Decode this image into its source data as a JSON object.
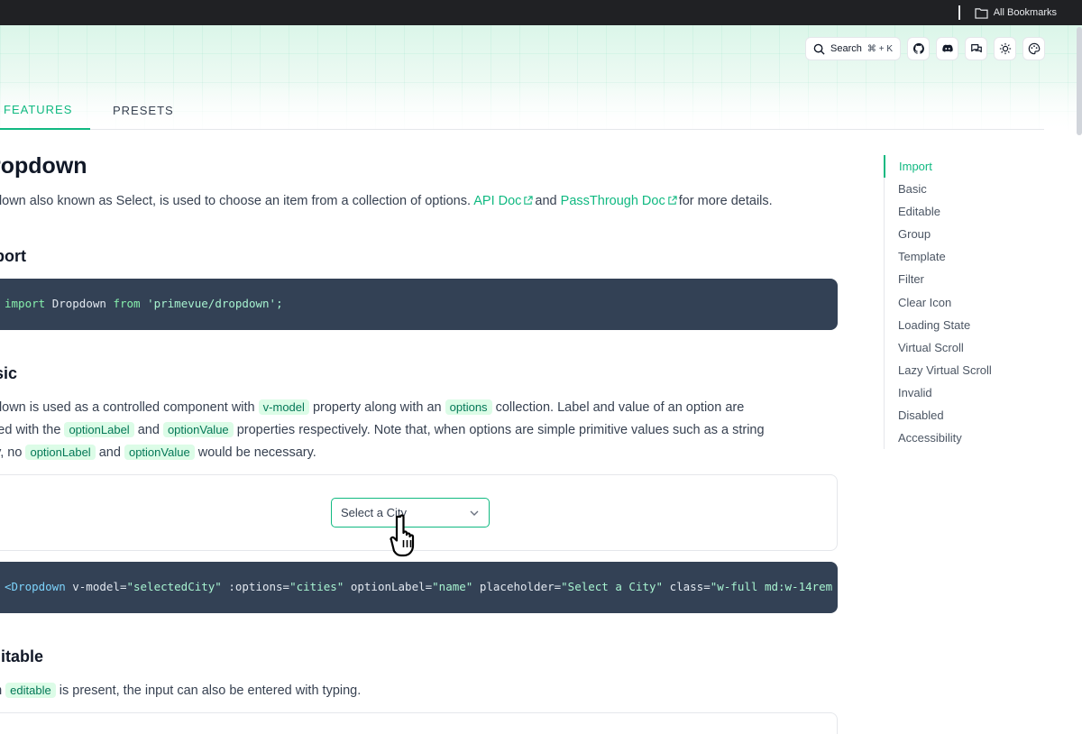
{
  "browser": {
    "bookmarks_label": "All Bookmarks"
  },
  "toolbar": {
    "search_label": "Search",
    "search_shortcut": "⌘ + K"
  },
  "tabs": [
    {
      "label": "FEATURES"
    },
    {
      "label": "PRESETS"
    }
  ],
  "page": {
    "title": "ropdown",
    "desc_pre": "pdown also known as Select, is used to choose an item from a collection of options.",
    "api_doc": "API Doc",
    "desc_and": "and",
    "pt_doc": "PassThrough Doc",
    "desc_post": "for more details."
  },
  "import_section": {
    "heading": "port",
    "code_kw1": "import",
    "code_mid": "Dropdown",
    "code_kw2": "from",
    "code_str": "'primevue/dropdown';"
  },
  "basic_section": {
    "heading": "sic",
    "line1_pre": "pdown is used as a controlled component with",
    "chip_vmodel": "v-model",
    "line1_mid": "property along with an",
    "chip_options": "options",
    "line1_post": "collection. Label and value of an option are",
    "line2_pre": "ined with the",
    "chip_optionlabel": "optionLabel",
    "line2_and": "and",
    "chip_optionvalue": "optionValue",
    "line2_post": "properties respectively. Note that, when options are simple primitive values such as a string",
    "line3_pre": "ay, no",
    "line3_and": "and",
    "line3_post": "would be necessary.",
    "select_placeholder": "Select a City",
    "code": {
      "tag": "<Dropdown",
      "attr1": " v-model=",
      "val1": "\"selectedCity\"",
      "attr2": " :options=",
      "val2": "\"cities\"",
      "attr3": " optionLabel=",
      "val3": "\"name\"",
      "attr4": " placeholder=",
      "val4": "\"Select a City\"",
      "attr5": " class=",
      "val5": "\"w-full md:w-14rem"
    }
  },
  "editable_section": {
    "heading": "litable",
    "line_pre": "en",
    "chip": "editable",
    "line_post": "is present, the input can also be entered with typing."
  },
  "toc": {
    "items": [
      {
        "label": "Import"
      },
      {
        "label": "Basic"
      },
      {
        "label": "Editable"
      },
      {
        "label": "Group"
      },
      {
        "label": "Template"
      },
      {
        "label": "Filter"
      },
      {
        "label": "Clear Icon"
      },
      {
        "label": "Loading State"
      },
      {
        "label": "Virtual Scroll"
      },
      {
        "label": "Lazy Virtual Scroll"
      },
      {
        "label": "Invalid"
      },
      {
        "label": "Disabled"
      },
      {
        "label": "Accessibility"
      }
    ]
  },
  "colors": {
    "accent": "#10b981",
    "code_bg": "#334155",
    "chip_bg": "#dcfce7"
  }
}
